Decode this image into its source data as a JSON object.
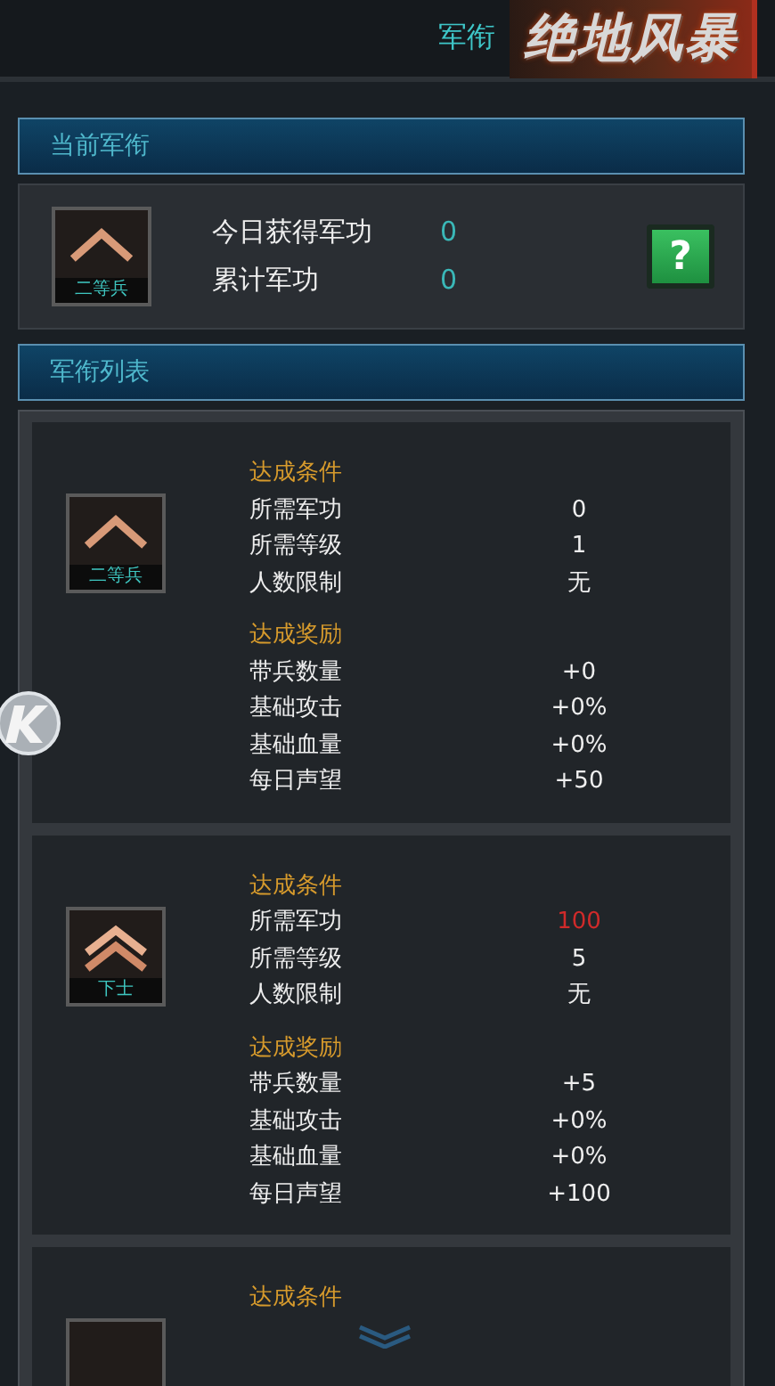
{
  "header": {
    "title": "军衔",
    "logo": "绝地风暴"
  },
  "current": {
    "heading": "当前军衔",
    "rank": {
      "name": "二等兵",
      "kind": "single"
    },
    "stats": [
      {
        "label": "今日获得军功",
        "value": "0"
      },
      {
        "label": "累计军功",
        "value": "0"
      }
    ],
    "help_button": "?"
  },
  "list": {
    "heading": "军衔列表",
    "ranks": [
      {
        "name": "二等兵",
        "kind": "single",
        "conditions": {
          "heading": "达成条件",
          "rows": [
            {
              "label": "所需军功",
              "value": "0",
              "met": true
            },
            {
              "label": "所需等级",
              "value": "1",
              "met": true
            },
            {
              "label": "人数限制",
              "value": "无",
              "met": true
            }
          ]
        },
        "rewards": {
          "heading": "达成奖励",
          "rows": [
            {
              "label": "带兵数量",
              "value": "+0"
            },
            {
              "label": "基础攻击",
              "value": "+0%"
            },
            {
              "label": "基础血量",
              "value": "+0%"
            },
            {
              "label": "每日声望",
              "value": "+50"
            }
          ]
        }
      },
      {
        "name": "下士",
        "kind": "double",
        "conditions": {
          "heading": "达成条件",
          "rows": [
            {
              "label": "所需军功",
              "value": "100",
              "met": false
            },
            {
              "label": "所需等级",
              "value": "5",
              "met": true
            },
            {
              "label": "人数限制",
              "value": "无",
              "met": true
            }
          ]
        },
        "rewards": {
          "heading": "达成奖励",
          "rows": [
            {
              "label": "带兵数量",
              "value": "+5"
            },
            {
              "label": "基础攻击",
              "value": "+0%"
            },
            {
              "label": "基础血量",
              "value": "+0%"
            },
            {
              "label": "每日声望",
              "value": "+100"
            }
          ]
        }
      },
      {
        "kind": "blank",
        "conditions": {
          "heading": "达成条件"
        }
      }
    ]
  }
}
